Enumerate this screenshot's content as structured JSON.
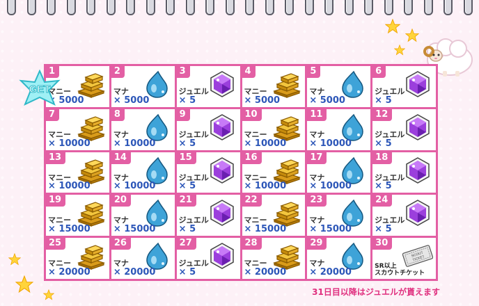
{
  "calendar": {
    "days": [
      {
        "day": "1",
        "type": "money",
        "name": "マニー",
        "qty": "× 5000",
        "got": true
      },
      {
        "day": "2",
        "type": "mana",
        "name": "マナ",
        "qty": "× 5000"
      },
      {
        "day": "3",
        "type": "jewel",
        "name": "ジュエル",
        "qty": "× 5"
      },
      {
        "day": "4",
        "type": "money",
        "name": "マニー",
        "qty": "× 5000"
      },
      {
        "day": "5",
        "type": "mana",
        "name": "マナ",
        "qty": "× 5000"
      },
      {
        "day": "6",
        "type": "jewel",
        "name": "ジュエル",
        "qty": "× 5"
      },
      {
        "day": "7",
        "type": "money",
        "name": "マニー",
        "qty": "× 10000"
      },
      {
        "day": "8",
        "type": "mana",
        "name": "マナ",
        "qty": "× 10000"
      },
      {
        "day": "9",
        "type": "jewel",
        "name": "ジュエル",
        "qty": "× 5"
      },
      {
        "day": "10",
        "type": "money",
        "name": "マニー",
        "qty": "× 10000"
      },
      {
        "day": "11",
        "type": "mana",
        "name": "マナ",
        "qty": "× 10000"
      },
      {
        "day": "12",
        "type": "jewel",
        "name": "ジュエル",
        "qty": "× 5"
      },
      {
        "day": "13",
        "type": "money",
        "name": "マニー",
        "qty": "× 10000"
      },
      {
        "day": "14",
        "type": "mana",
        "name": "マナ",
        "qty": "× 10000"
      },
      {
        "day": "15",
        "type": "jewel",
        "name": "ジュエル",
        "qty": "× 5"
      },
      {
        "day": "16",
        "type": "money",
        "name": "マニー",
        "qty": "× 10000"
      },
      {
        "day": "17",
        "type": "mana",
        "name": "マナ",
        "qty": "× 10000"
      },
      {
        "day": "18",
        "type": "jewel",
        "name": "ジュエル",
        "qty": "× 5"
      },
      {
        "day": "19",
        "type": "money",
        "name": "マニー",
        "qty": "× 15000"
      },
      {
        "day": "20",
        "type": "mana",
        "name": "マナ",
        "qty": "× 15000"
      },
      {
        "day": "21",
        "type": "jewel",
        "name": "ジュエル",
        "qty": "× 5"
      },
      {
        "day": "22",
        "type": "money",
        "name": "マニー",
        "qty": "× 15000"
      },
      {
        "day": "23",
        "type": "mana",
        "name": "マナ",
        "qty": "× 15000"
      },
      {
        "day": "24",
        "type": "jewel",
        "name": "ジュエル",
        "qty": "× 5"
      },
      {
        "day": "25",
        "type": "money",
        "name": "マニー",
        "qty": "× 20000"
      },
      {
        "day": "26",
        "type": "mana",
        "name": "マナ",
        "qty": "× 20000"
      },
      {
        "day": "27",
        "type": "jewel",
        "name": "ジュエル",
        "qty": "× 5"
      },
      {
        "day": "28",
        "type": "money",
        "name": "マニー",
        "qty": "× 20000"
      },
      {
        "day": "29",
        "type": "mana",
        "name": "マナ",
        "qty": "× 20000"
      },
      {
        "day": "30",
        "type": "ticket",
        "name": "SR以上\nスカウトチケット",
        "ticket_label": "SCOUT TICKET"
      }
    ],
    "get_badge": "GET",
    "footer_note": "31日目以降はジュエルが貰えます"
  },
  "colors": {
    "accent": "#e35fa4",
    "qty_text": "#2c56b8",
    "footer_text": "#e0307f",
    "background": "#fdf1f7"
  }
}
